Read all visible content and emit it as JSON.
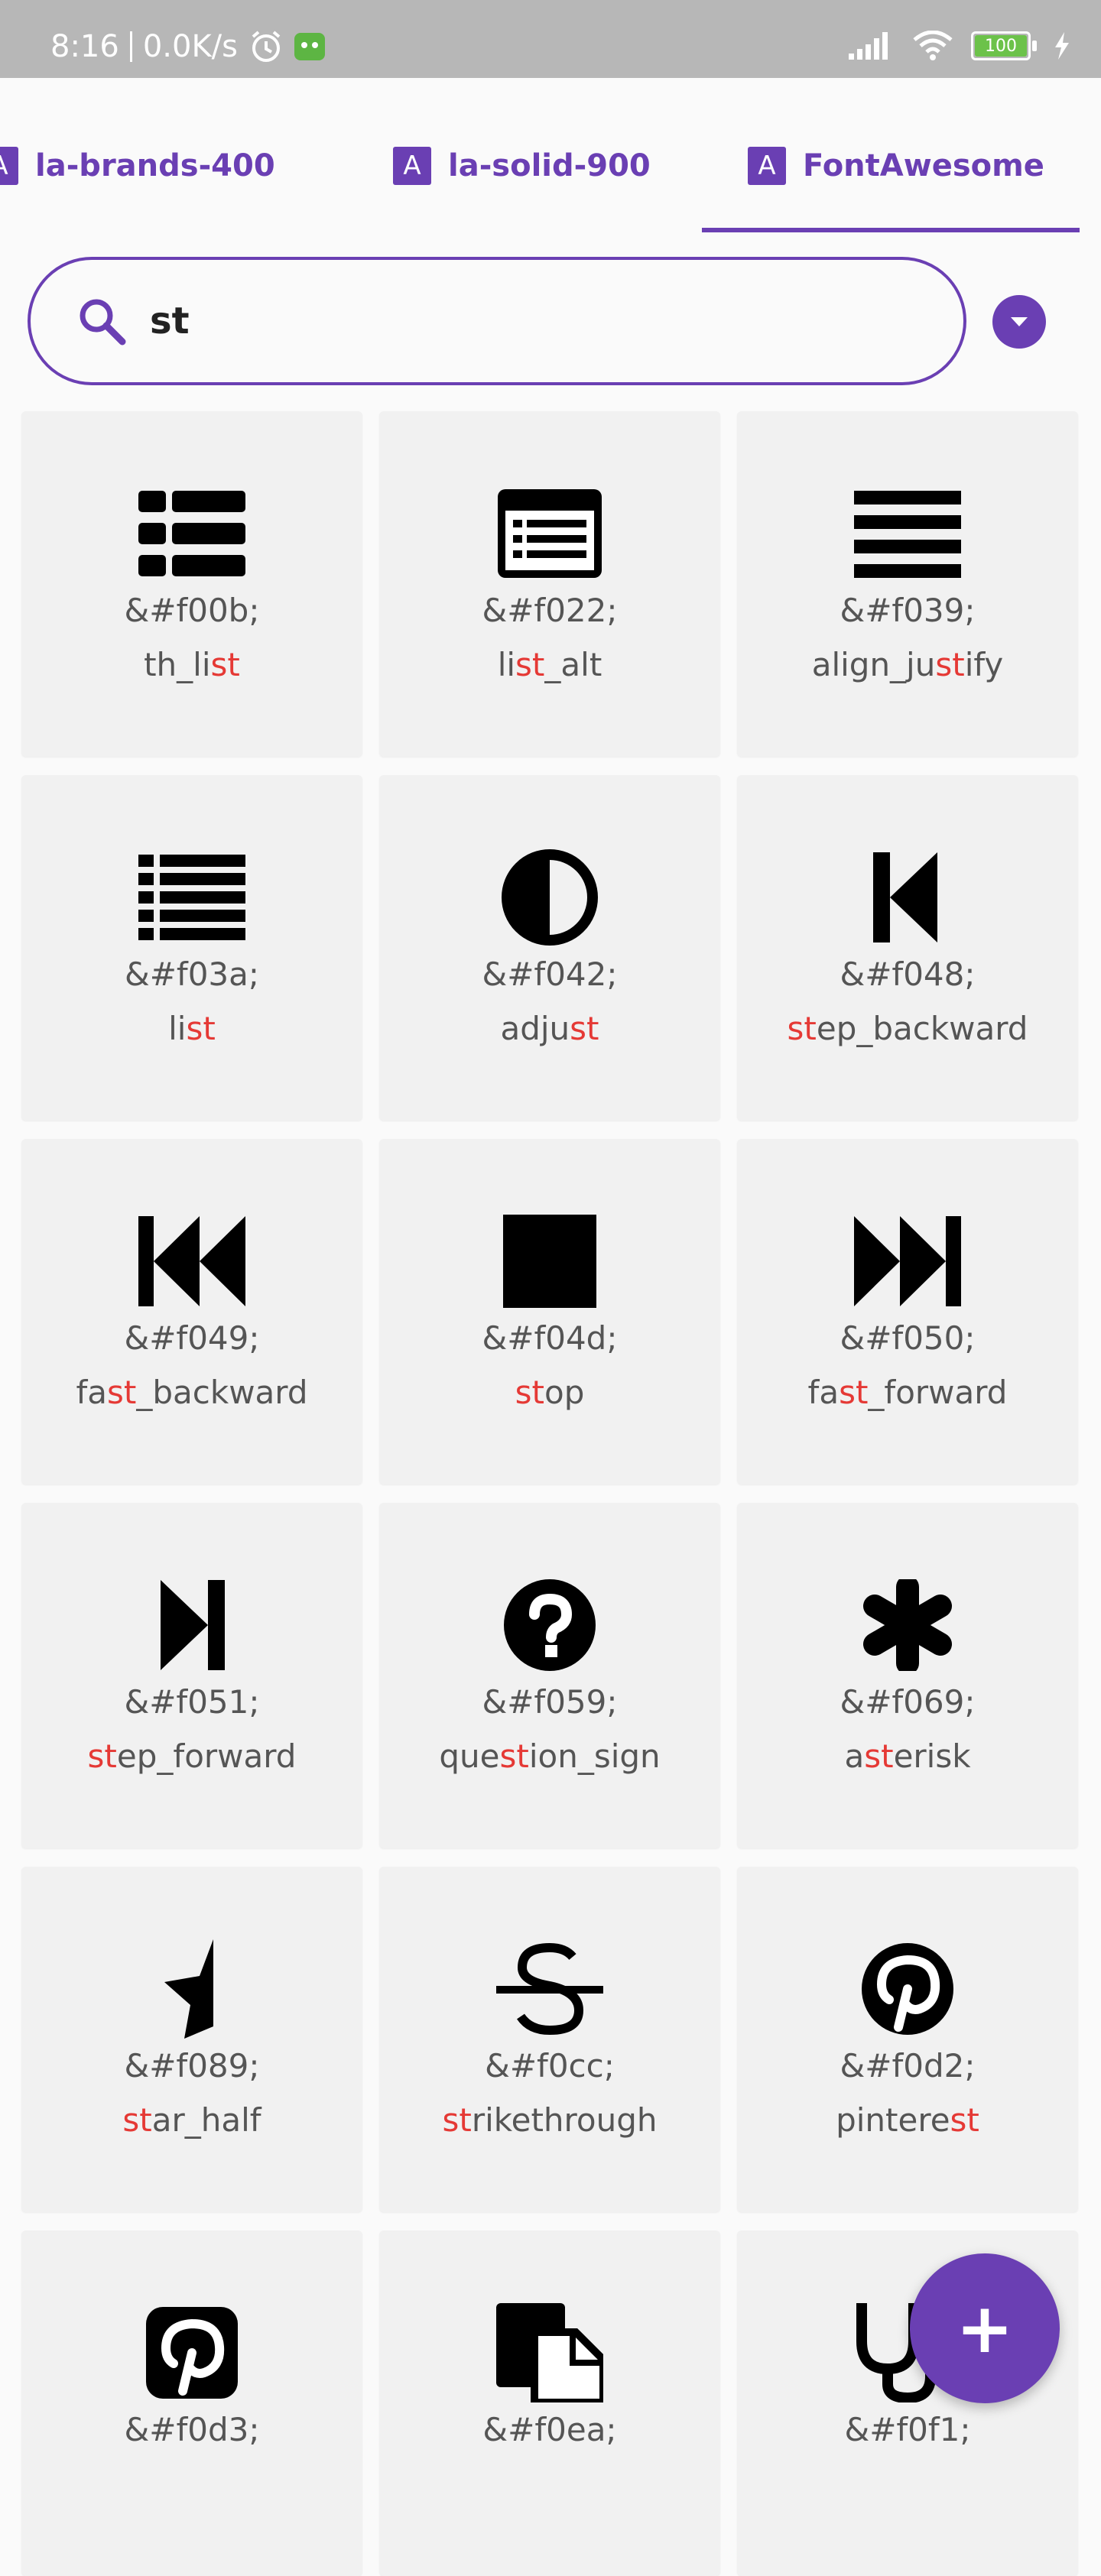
{
  "status_bar": {
    "time": "8:16",
    "speed": "0.0K/s",
    "battery": "100"
  },
  "tabs": [
    {
      "icon": "A",
      "label": "la-brands-400"
    },
    {
      "icon": "A",
      "label": "la-solid-900"
    },
    {
      "icon": "A",
      "label": "FontAwesome"
    }
  ],
  "search": {
    "value": "st",
    "placeholder": ""
  },
  "icons": [
    {
      "code": "&#f00b;",
      "pre": "th_li",
      "hl": "st",
      "post": "",
      "icon": "th-list-icon"
    },
    {
      "code": "&#f022;",
      "pre": "li",
      "hl": "st",
      "post": "_alt",
      "icon": "list-alt-icon"
    },
    {
      "code": "&#f039;",
      "pre": "align_ju",
      "hl": "st",
      "post": "ify",
      "icon": "align-justify-icon"
    },
    {
      "code": "&#f03a;",
      "pre": "li",
      "hl": "st",
      "post": "",
      "icon": "list-icon"
    },
    {
      "code": "&#f042;",
      "pre": "adju",
      "hl": "st",
      "post": "",
      "icon": "adjust-icon"
    },
    {
      "code": "&#f048;",
      "pre": "",
      "hl": "st",
      "post": "ep_backward",
      "icon": "step-backward-icon"
    },
    {
      "code": "&#f049;",
      "pre": "fa",
      "hl": "st",
      "post": "_backward",
      "icon": "fast-backward-icon"
    },
    {
      "code": "&#f04d;",
      "pre": "",
      "hl": "st",
      "post": "op",
      "icon": "stop-icon"
    },
    {
      "code": "&#f050;",
      "pre": "fa",
      "hl": "st",
      "post": "_forward",
      "icon": "fast-forward-icon"
    },
    {
      "code": "&#f051;",
      "pre": "",
      "hl": "st",
      "post": "ep_forward",
      "icon": "step-forward-icon"
    },
    {
      "code": "&#f059;",
      "pre": "que",
      "hl": "st",
      "post": "ion_sign",
      "icon": "question-sign-icon"
    },
    {
      "code": "&#f069;",
      "pre": "a",
      "hl": "st",
      "post": "erisk",
      "icon": "asterisk-icon"
    },
    {
      "code": "&#f089;",
      "pre": "",
      "hl": "st",
      "post": "ar_half",
      "icon": "star-half-icon"
    },
    {
      "code": "&#f0cc;",
      "pre": "",
      "hl": "st",
      "post": "rikethrough",
      "icon": "strikethrough-icon"
    },
    {
      "code": "&#f0d2;",
      "pre": "pintere",
      "hl": "st",
      "post": "",
      "icon": "pinterest-icon"
    },
    {
      "code": "&#f0d3;",
      "pre": "",
      "hl": "",
      "post": "",
      "icon": "pinterest-square-icon"
    },
    {
      "code": "&#f0ea;",
      "pre": "",
      "hl": "",
      "post": "",
      "icon": "paste-icon"
    },
    {
      "code": "&#f0f1;",
      "pre": "",
      "hl": "",
      "post": "",
      "icon": "stethoscope-icon"
    }
  ],
  "fab": {
    "label": "+"
  }
}
